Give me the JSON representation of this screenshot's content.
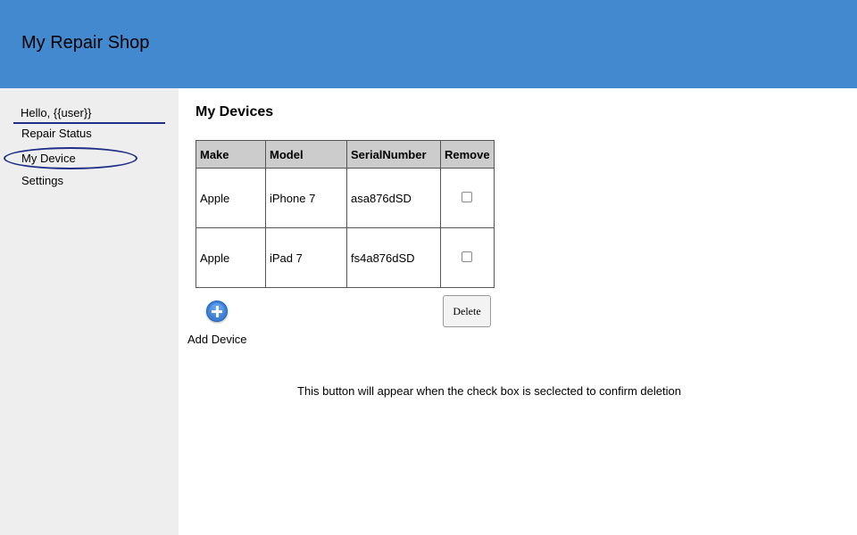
{
  "header": {
    "title": "My Repair Shop"
  },
  "sidebar": {
    "greeting": "Hello, {{user}}",
    "items": [
      {
        "label": "Repair Status"
      },
      {
        "label": "My Device",
        "active": true
      },
      {
        "label": "Settings"
      }
    ]
  },
  "main": {
    "title": "My Devices",
    "table": {
      "headers": [
        "Make",
        "Model",
        "SerialNumber",
        "Remove"
      ],
      "rows": [
        {
          "make": "Apple",
          "model": "iPhone 7",
          "serial": "asa876dSD",
          "remove": false
        },
        {
          "make": "Apple",
          "model": "iPad 7",
          "serial": "fs4a876dSD",
          "remove": false
        }
      ]
    },
    "add_device_label": "Add Device",
    "delete_label": "Delete",
    "note": "This button will appear when the check box is seclected to confirm deletion"
  },
  "icons": {
    "add": "plus-circle-icon"
  },
  "colors": {
    "header_bg": "#4389cf",
    "sidebar_bg": "#eeeeee",
    "highlight": "#1f2f87",
    "table_header_bg": "#cccccc"
  }
}
